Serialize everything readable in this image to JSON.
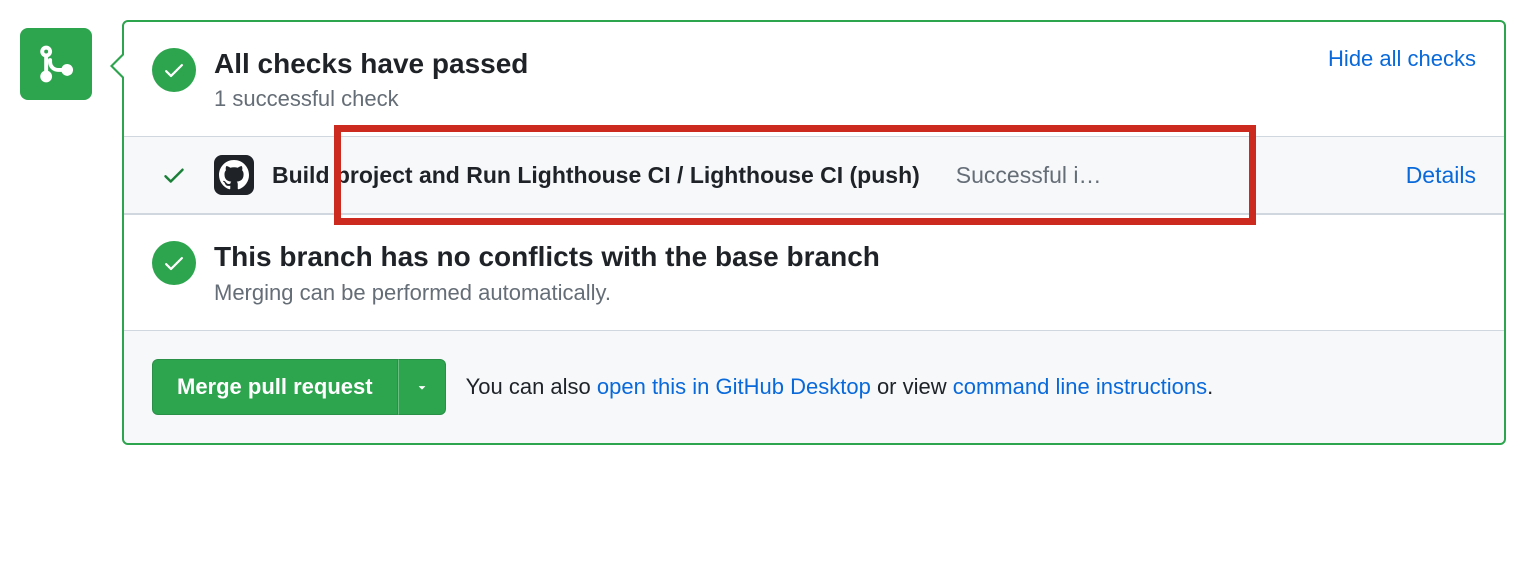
{
  "checks": {
    "title": "All checks have passed",
    "subtitle": "1 successful check",
    "toggle_label": "Hide all checks",
    "items": [
      {
        "name": "Build project and Run Lighthouse CI / Lighthouse CI (push)",
        "status_text": "Successful i…",
        "details_label": "Details"
      }
    ]
  },
  "conflicts": {
    "title": "This branch has no conflicts with the base branch",
    "subtitle": "Merging can be performed automatically."
  },
  "merge": {
    "button_label": "Merge pull request",
    "hint_prefix": "You can also ",
    "desktop_link": "open this in GitHub Desktop",
    "hint_mid": " or view ",
    "cli_link": "command line instructions",
    "hint_suffix": "."
  }
}
